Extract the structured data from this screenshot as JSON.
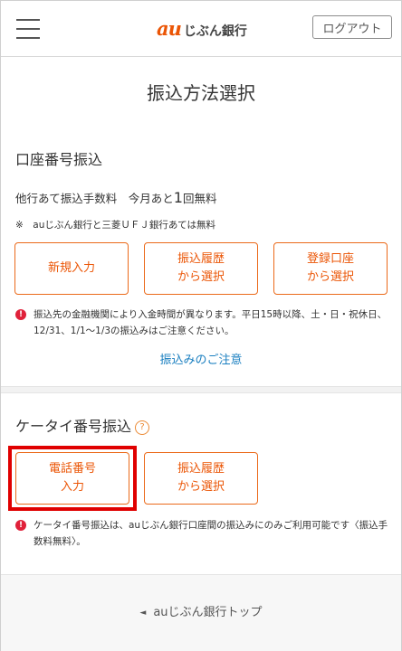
{
  "header": {
    "logo_au": "au",
    "logo_bank": "じぶん銀行",
    "logout_label": "ログアウト"
  },
  "page_title": "振込方法選択",
  "account_transfer": {
    "title": "口座番号振込",
    "fee_prefix": "他行あて振込手数料　今月あと",
    "fee_count": "1",
    "fee_suffix": "回無料",
    "free_note": "※　auじぶん銀行と三菱ＵＦＪ銀行あては無料",
    "buttons": {
      "new_input": "新規入力",
      "history": "振込履歴\nから選択",
      "registered": "登録口座\nから選択"
    },
    "warning": "振込先の金融機関により入金時間が異なります。平日15時以降、土・日・祝休日、12/31、1/1～1/3の振込みはご注意ください。",
    "caution_link": "振込みのご注意"
  },
  "mobile_transfer": {
    "title": "ケータイ番号振込",
    "help_mark": "?",
    "buttons": {
      "phone_input": "電話番号\n入力",
      "history": "振込履歴\nから選択"
    },
    "warning": "ケータイ番号振込は、auじぶん銀行口座間の振込みにのみご利用可能です〈振込手数料無料〉。"
  },
  "footer": {
    "arrow": "◄",
    "top_link": "auじぶん銀行トップ"
  },
  "colors": {
    "brand_orange": "#eb5505",
    "link_blue": "#1a7fc0",
    "warning_red": "#e0213a",
    "highlight_red": "#e00000"
  }
}
